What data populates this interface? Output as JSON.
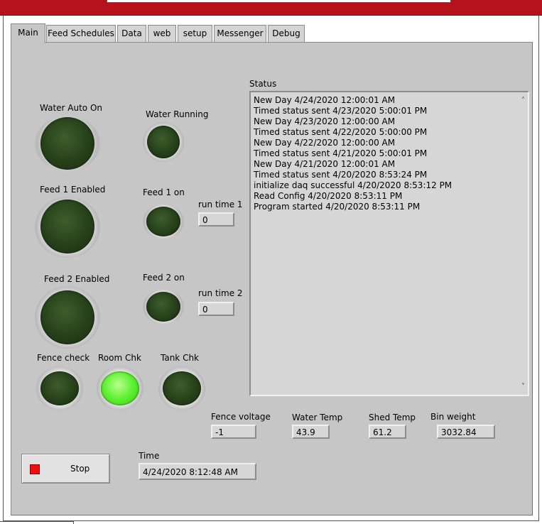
{
  "tabs": [
    {
      "label": "Main"
    },
    {
      "label": "Feed Schedules"
    },
    {
      "label": "Data"
    },
    {
      "label": "web"
    },
    {
      "label": "setup"
    },
    {
      "label": "Messenger"
    },
    {
      "label": "Debug"
    }
  ],
  "indicators": {
    "water_auto_on": {
      "label": "Water Auto On",
      "state": "off"
    },
    "water_running": {
      "label": "Water Running",
      "state": "off"
    },
    "feed1_enabled": {
      "label": "Feed 1 Enabled",
      "state": "off"
    },
    "feed1_on": {
      "label": "Feed 1 on",
      "state": "off"
    },
    "feed2_enabled": {
      "label": "Feed 2 Enabled",
      "state": "off"
    },
    "feed2_on": {
      "label": "Feed 2 on",
      "state": "off"
    },
    "fence_check": {
      "label": "Fence check",
      "state": "off"
    },
    "room_chk": {
      "label": "Room Chk",
      "state": "on"
    },
    "tank_chk": {
      "label": "Tank Chk",
      "state": "off"
    }
  },
  "run_time_1": {
    "label": "run time 1",
    "value": "0"
  },
  "run_time_2": {
    "label": "run time 2",
    "value": "0"
  },
  "status": {
    "label": "Status",
    "lines": [
      "New Day 4/24/2020 12:00:01 AM",
      "Timed status sent  4/23/2020 5:00:01 PM",
      "New Day 4/23/2020 12:00:00 AM",
      "Timed status sent  4/22/2020 5:00:00 PM",
      "New Day 4/22/2020 12:00:00 AM",
      "Timed status sent  4/21/2020 5:00:01 PM",
      "New Day 4/21/2020 12:00:01 AM",
      "Timed status sent  4/20/2020 8:53:24 PM",
      "initialize daq  successful  4/20/2020 8:53:12 PM",
      "Read Config 4/20/2020 8:53:11 PM",
      "Program started 4/20/2020 8:53:11 PM"
    ]
  },
  "readings": {
    "fence_voltage": {
      "label": "Fence voltage",
      "value": "-1"
    },
    "water_temp": {
      "label": "Water Temp",
      "value": "43.9"
    },
    "shed_temp": {
      "label": "Shed Temp",
      "value": "61.2"
    },
    "bin_weight": {
      "label": "Bin weight",
      "value": "3032.84"
    }
  },
  "stop_button": {
    "label": "Stop"
  },
  "time": {
    "label": "Time",
    "value": "4/24/2020 8:12:48 AM"
  },
  "colors": {
    "title_bar": "#b5121b",
    "led_off": "#26401a",
    "led_on": "#5cf02f",
    "stop_square": "#ef0f0f",
    "panel": "#c6c6c6"
  }
}
